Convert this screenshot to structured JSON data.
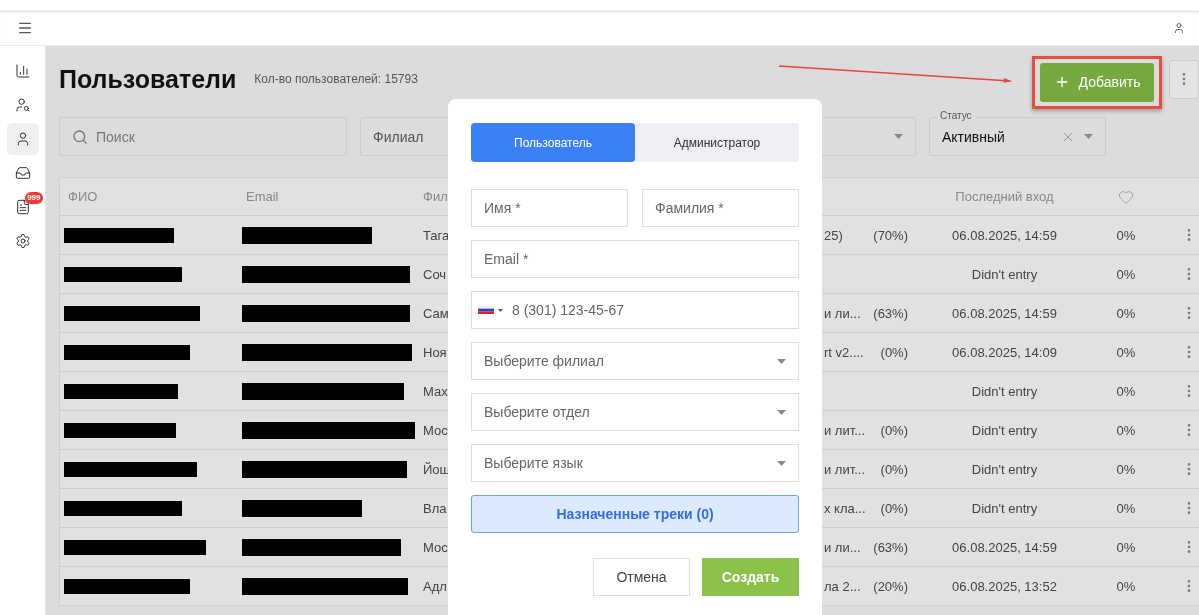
{
  "sidebar": {
    "items": [
      {
        "selected": false
      },
      {
        "selected": false
      },
      {
        "selected": true
      },
      {
        "selected": false
      },
      {
        "selected": false,
        "badge": "999"
      },
      {
        "selected": false
      }
    ]
  },
  "page": {
    "title": "Пользователи",
    "count": "Кол-во пользователей: 15793",
    "add_button": "Добавить"
  },
  "filters": {
    "search": {
      "placeholder": "Поиск"
    },
    "branch": {
      "placeholder": "Филиал"
    },
    "status": {
      "label": "Статус",
      "value": "Активный"
    }
  },
  "table": {
    "columns": [
      "ФИО",
      "Email",
      "Фил",
      "Последний вход"
    ],
    "rows": [
      {
        "branch": "Тага",
        "course": "25)",
        "progress": "(70%)",
        "last_login": "06.08.2025, 14:59",
        "percent": "0%"
      },
      {
        "branch": "Соч",
        "last_login": "Didn't entry",
        "percent": "0%"
      },
      {
        "branch": "Сам",
        "course": "и ли...",
        "progress": "(63%)",
        "last_login": "06.08.2025, 14:59",
        "percent": "0%"
      },
      {
        "branch": "Ноя",
        "course": "rt v2....",
        "progress": "(0%)",
        "last_login": "06.08.2025, 14:09",
        "percent": "0%"
      },
      {
        "branch": "Мах",
        "last_login": "Didn't entry",
        "percent": "0%"
      },
      {
        "branch": "Мос",
        "course": "и лит...",
        "progress": "(0%)",
        "last_login": "Didn't entry",
        "percent": "0%"
      },
      {
        "branch": "Йош",
        "course": "и лит...",
        "progress": "(0%)",
        "last_login": "Didn't entry",
        "percent": "0%"
      },
      {
        "branch": "Вла",
        "course": "х кла...",
        "progress": "(0%)",
        "last_login": "Didn't entry",
        "percent": "0%"
      },
      {
        "branch": "Мос",
        "course": "и ли...",
        "progress": "(63%)",
        "last_login": "06.08.2025, 14:59",
        "percent": "0%"
      },
      {
        "branch": "Адл",
        "course": "ла 2...",
        "progress": "(20%)",
        "last_login": "06.08.2025, 13:52",
        "percent": "0%"
      }
    ]
  },
  "modal": {
    "tabs": [
      {
        "label": "Пользователь",
        "selected": true
      },
      {
        "label": "Администратор",
        "selected": false
      }
    ],
    "rows": [
      [
        {
          "kind": "text",
          "placeholder": "Имя *"
        },
        {
          "kind": "text",
          "placeholder": "Фамилия *"
        }
      ],
      [
        {
          "kind": "text",
          "placeholder": "Email *"
        }
      ],
      [
        {
          "kind": "phone",
          "placeholder": "8 (301) 123-45-67"
        }
      ],
      [
        {
          "kind": "select",
          "placeholder": "Выберите филиал"
        }
      ],
      [
        {
          "kind": "select",
          "placeholder": "Выберите отдел"
        }
      ],
      [
        {
          "kind": "select",
          "placeholder": "Выберите язык"
        }
      ]
    ],
    "tracks_button": "Назначенные треки (0)",
    "buttons": [
      {
        "kind": "secondary",
        "label": "Отмена"
      },
      {
        "kind": "primary",
        "label": "Создать"
      }
    ]
  }
}
